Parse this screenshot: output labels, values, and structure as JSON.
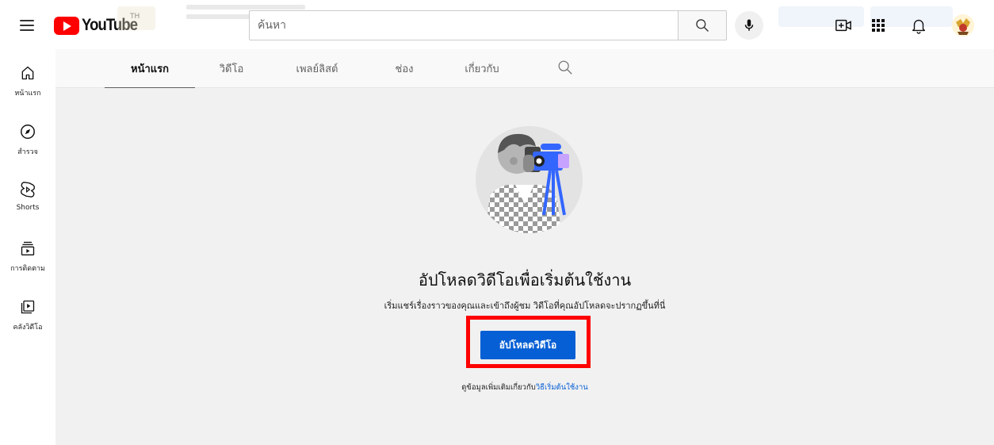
{
  "header": {
    "logo_text": "YouTube",
    "country_code": "TH",
    "search": {
      "placeholder": "ค้นหา",
      "value": ""
    }
  },
  "sidebar": {
    "items": [
      {
        "label": "หน้าแรก",
        "icon": "home-icon"
      },
      {
        "label": "สำรวจ",
        "icon": "explore-compass-icon"
      },
      {
        "label": "Shorts",
        "icon": "shorts-icon"
      },
      {
        "label": "การติดตาม",
        "icon": "subscriptions-icon"
      },
      {
        "label": "คลังวิดีโอ",
        "icon": "library-icon"
      }
    ]
  },
  "tabs": [
    {
      "label": "หน้าแรก",
      "active": true
    },
    {
      "label": "วิดีโอ",
      "active": false
    },
    {
      "label": "เพลย์ลิสต์",
      "active": false
    },
    {
      "label": "ช่อง",
      "active": false
    },
    {
      "label": "เกี่ยวกับ",
      "active": false
    }
  ],
  "empty_state": {
    "title": "อัปโหลดวิดีโอเพื่อเริ่มต้นใช้งาน",
    "subtitle": "เริ่มแชร์เรื่องราวของคุณและเข้าถึงผู้ชม วิดีโอที่คุณอัปโหลดจะปรากฏขึ้นที่นี่",
    "button_label": "อัปโหลดวิดีโอ",
    "learn_more_prefix": "ดูข้อมูลเพิ่มเติมเกี่ยวกับ",
    "learn_more_link": "วิธีเริ่มต้นใช้งาน"
  },
  "colors": {
    "accent": "#065fd4",
    "highlight": "#ff0000",
    "brand": "#ff0000",
    "main_bg": "#f1f1f1"
  }
}
